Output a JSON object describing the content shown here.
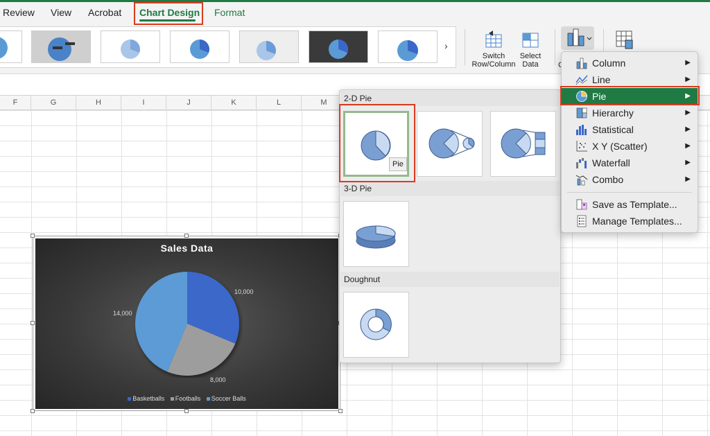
{
  "ribbon": {
    "tabs": [
      {
        "label": "Review"
      },
      {
        "label": "View"
      },
      {
        "label": "Acrobat"
      },
      {
        "label": "Chart Design"
      },
      {
        "label": "Format"
      }
    ],
    "active_tab": "Chart Design",
    "switch_label_1": "Switch",
    "switch_label_2": "Row/Column",
    "select_label_1": "Select",
    "select_label_2": "Data",
    "change_type_label_fragment": "C"
  },
  "sheet": {
    "columns": [
      "F",
      "G",
      "H",
      "I",
      "J",
      "K",
      "L",
      "M"
    ]
  },
  "chart": {
    "title": "Sales Data",
    "labels": {
      "basketballs": "10,000",
      "footballs": "8,000",
      "soccer": "14,000"
    },
    "legend": [
      "Basketballs",
      "Footballs",
      "Soccer Balls"
    ],
    "colors": {
      "basketballs": "#3a67c9",
      "footballs": "#9d9d9d",
      "soccer": "#5b9bd5"
    }
  },
  "chart_data": {
    "type": "pie",
    "title": "Sales Data",
    "categories": [
      "Basketballs",
      "Footballs",
      "Soccer Balls"
    ],
    "values": [
      10000,
      8000,
      14000
    ],
    "legend_position": "bottom"
  },
  "gallery": {
    "sections": {
      "pie2d": "2-D Pie",
      "pie3d": "3-D Pie",
      "doughnut": "Doughnut"
    },
    "tooltip": "Pie"
  },
  "menu": {
    "items": [
      {
        "label": "Column",
        "icon": "column-chart-icon",
        "submenu": true
      },
      {
        "label": "Line",
        "icon": "line-chart-icon",
        "submenu": true
      },
      {
        "label": "Pie",
        "icon": "pie-chart-icon",
        "submenu": true
      },
      {
        "label": "Hierarchy",
        "icon": "hierarchy-chart-icon",
        "submenu": true
      },
      {
        "label": "Statistical",
        "icon": "statistical-chart-icon",
        "submenu": true
      },
      {
        "label": "X Y (Scatter)",
        "icon": "scatter-chart-icon",
        "submenu": true
      },
      {
        "label": "Waterfall",
        "icon": "waterfall-chart-icon",
        "submenu": true
      },
      {
        "label": "Combo",
        "icon": "combo-chart-icon",
        "submenu": true
      },
      {
        "label": "Save as Template...",
        "icon": "save-template-icon",
        "submenu": false
      },
      {
        "label": "Manage Templates...",
        "icon": "manage-templates-icon",
        "submenu": false
      }
    ],
    "highlighted": "Pie",
    "arrow": "▶"
  },
  "icons": {
    "gallery_next": "›"
  },
  "colors": {
    "accent_green": "#1f7a43",
    "highlight_red": "#d93a1f"
  }
}
